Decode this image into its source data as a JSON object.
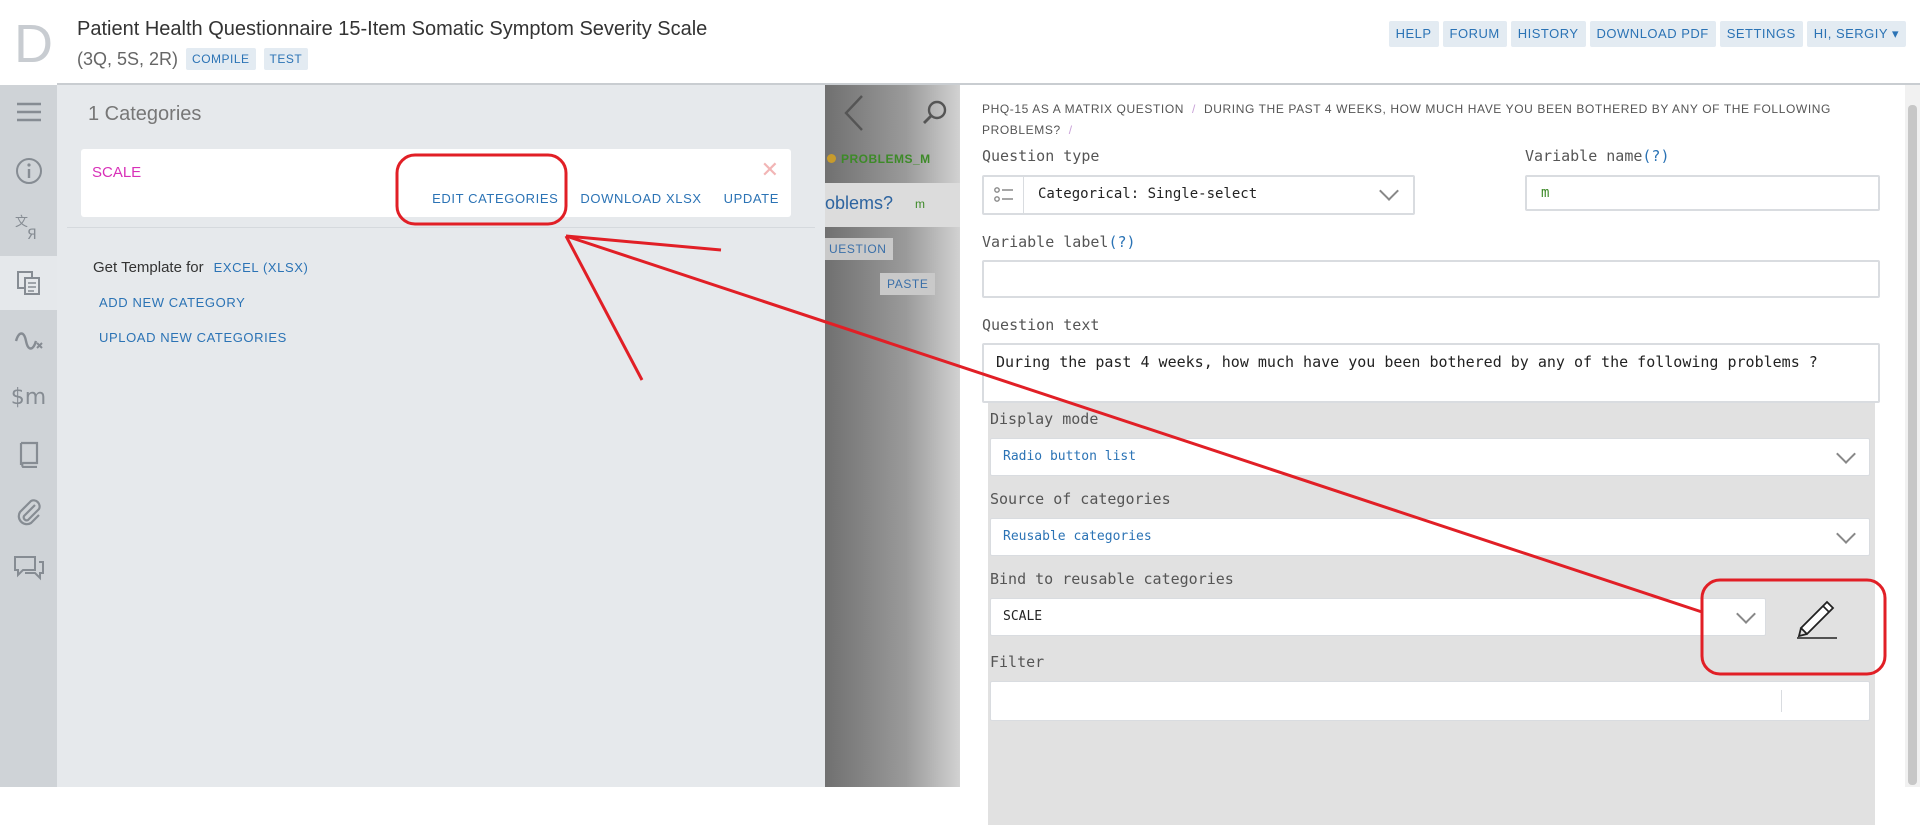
{
  "header": {
    "logo": "D",
    "title": "Patient Health Questionnaire 15-Item Somatic Symptom Severity Scale",
    "counts": "(3Q, 5S, 2R)",
    "compile_label": "COMPILE",
    "test_label": "TEST",
    "nav": [
      "HELP",
      "FORUM",
      "HISTORY",
      "DOWNLOAD PDF",
      "SETTINGS",
      "HI, SERGIY"
    ]
  },
  "rail": {
    "items": [
      "menu-icon",
      "info-icon",
      "translation-icon",
      "categories-icon",
      "macros-icon",
      "variables-icon",
      "book-icon",
      "attachment-icon",
      "comments-icon"
    ],
    "active": "categories-icon"
  },
  "categories": {
    "count_label": "1 Categories",
    "items": [
      {
        "name": "SCALE",
        "edit_label": "EDIT CATEGORIES",
        "download_label": "DOWNLOAD XLSX",
        "update_label": "UPDATE"
      }
    ],
    "template_label": "Get Template for",
    "template_link": "EXCEL (XLSX)",
    "add_label": "ADD NEW CATEGORY",
    "upload_label": "UPLOAD NEW CATEGORIES"
  },
  "middle": {
    "tag": "PROBLEMS_M",
    "text": "oblems?",
    "var": "m",
    "question_label": "UESTION",
    "paste_label": "PASTE"
  },
  "editor": {
    "breadcrumb": [
      "PHQ-15 AS A MATRIX QUESTION",
      "DURING THE PAST 4 WEEKS, HOW MUCH HAVE YOU BEEN BOTHERED BY ANY OF THE FOLLOWING PROBLEMS?"
    ],
    "question_type_label": "Question type",
    "question_type_value": "Categorical: Single-select",
    "variable_name_label": "Variable name",
    "variable_name_value": "m",
    "variable_label_label": "Variable label",
    "variable_label_value": "",
    "question_text_label": "Question text",
    "question_text_value": "During the past 4 weeks, how much have you been bothered by any of the following problems ?",
    "display_mode_label": "Display mode",
    "display_mode_value": "Radio button list",
    "source_label": "Source of categories",
    "source_value": "Reusable categories",
    "bind_label": "Bind to reusable categories",
    "bind_value": "SCALE",
    "filter_label": "Filter",
    "filter_value": "",
    "help_mark": "(?)"
  },
  "colors": {
    "accent": "#2b73b5",
    "category_name": "#d830b8",
    "variable": "#3d8a28",
    "annotation": "#e11f26"
  }
}
